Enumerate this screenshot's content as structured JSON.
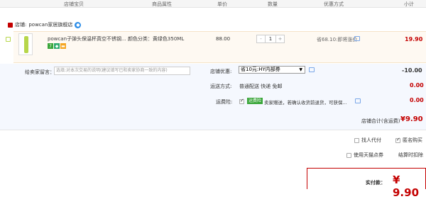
{
  "header": {
    "col_shop_item": "店铺宝贝",
    "col_attr": "商品属性",
    "col_price": "单价",
    "col_qty": "数量",
    "col_promo": "优惠方式",
    "col_subtotal": "小计"
  },
  "shop": {
    "label": "店铺:",
    "name": "powcan家居旗舰店"
  },
  "item": {
    "title": "powcan子弹头保温杯真空不锈钢...",
    "attr": "颜色分类：黄绿色350ML",
    "price": "88.00",
    "qty": "1",
    "minus": "-",
    "plus": "+",
    "promo": "省68.10:即将涨价",
    "subtotal": "19.90"
  },
  "message": {
    "label": "给卖家留言：",
    "placeholder": "选填:对本次交易的说明(建议填写已和卖家协商一致的内容)"
  },
  "shop_discount": {
    "label": "店铺优惠:",
    "selected": "省10元:HY内部券",
    "amount": "-10.00"
  },
  "shipping": {
    "label": "运送方式:",
    "value": "普通配送 快递 免邮",
    "amount": "0.00"
  },
  "insurance": {
    "label": "运费险:",
    "badge": "运费险",
    "value": "卖家赠送，若确认收货前退货，可获保...",
    "amount": "0.00"
  },
  "shop_total": {
    "label": "店铺合计(含运费)",
    "value": "¥9.90"
  },
  "options": {
    "proxy_pay": "找人代付",
    "anonymous": "匿名购买",
    "tmall_points": "使用天猫点券",
    "settle_time": "结算时扣除"
  },
  "payment": {
    "label": "实付款：",
    "value": "¥ 9.90"
  },
  "colors": {
    "accent": "#c40000",
    "highlight_bg": "#f5f8fe"
  }
}
